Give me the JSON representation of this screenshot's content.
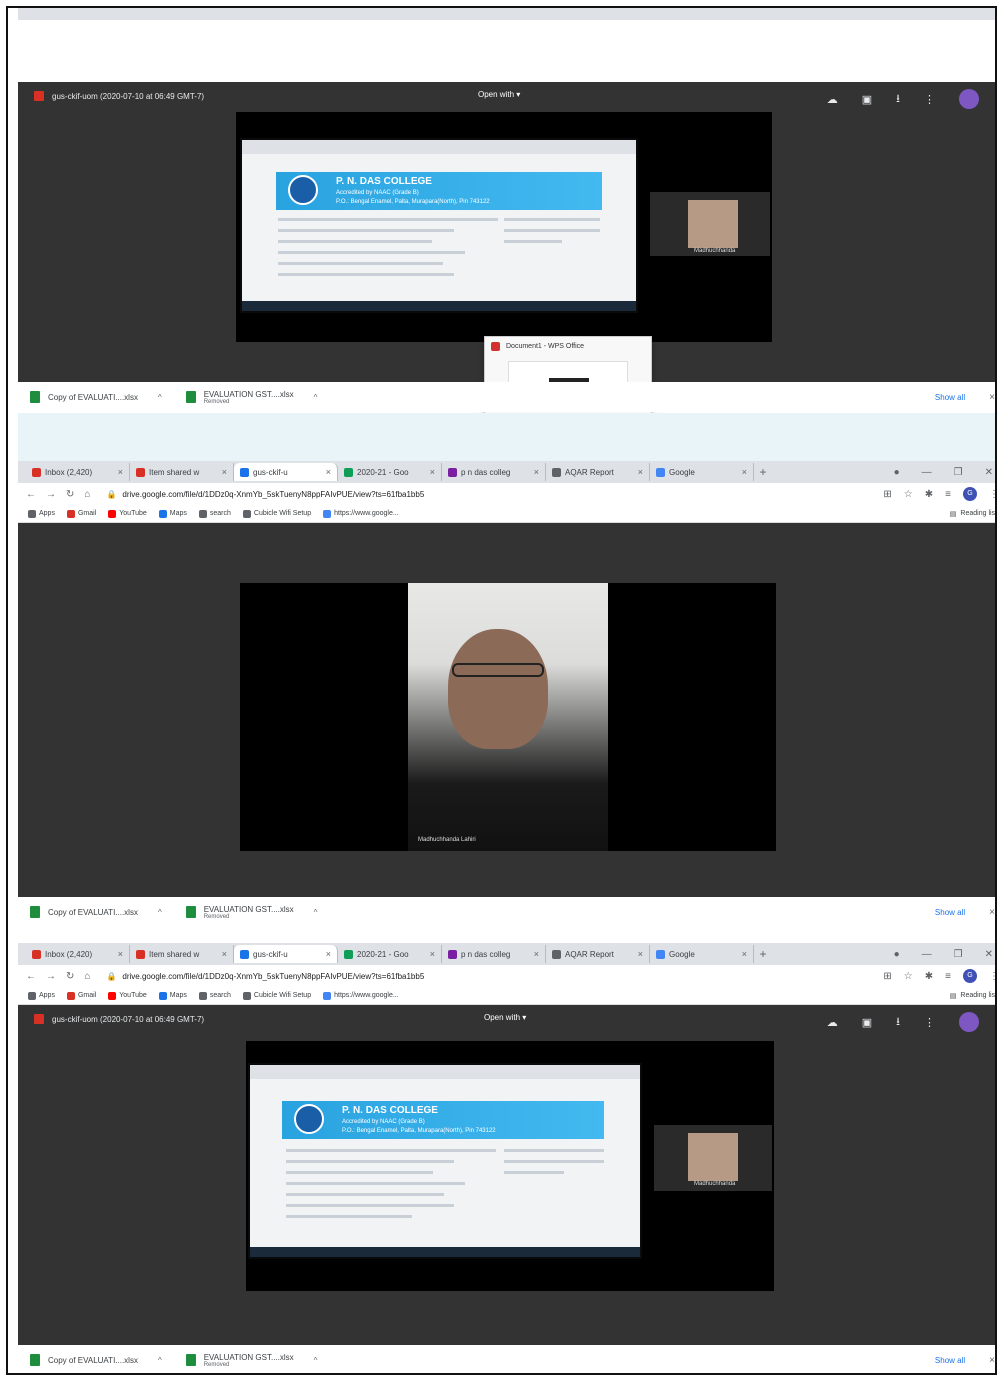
{
  "browser": {
    "tabs": [
      {
        "label": "Inbox (2,420)",
        "color": "#d93025"
      },
      {
        "label": "Item shared w",
        "color": "#d93025"
      },
      {
        "label": "gus-ckif-u",
        "color": "#1a73e8",
        "active": true
      },
      {
        "label": "2020-21 - Goo",
        "color": "#0f9d58"
      },
      {
        "label": "p n das colleg",
        "color": "#7b1fa2"
      },
      {
        "label": "AQAR Report",
        "color": "#5f6368"
      },
      {
        "label": "Google",
        "color": "#4285f4"
      }
    ],
    "new_tab": "+",
    "url": "drive.google.com/file/d/1DDz0q-XnmYb_5skTuenyN8ppFAIvPUE/view?ts=61fba1bb5",
    "bookmarks": [
      {
        "label": "Apps",
        "color": "#5f6368"
      },
      {
        "label": "Gmail",
        "color": "#d93025"
      },
      {
        "label": "YouTube",
        "color": "#ff0000"
      },
      {
        "label": "Maps",
        "color": "#1a73e8"
      },
      {
        "label": "search",
        "color": "#5f6368"
      },
      {
        "label": "Cubicle Wifi Setup",
        "color": "#5f6368"
      },
      {
        "label": "https://www.google...",
        "color": "#4285f4"
      }
    ],
    "reading_list": "Reading list",
    "profile_initial": "G"
  },
  "viewer": {
    "file_title": "gus-ckif-uom (2020-07-10 at 06:49 GMT-7)",
    "open_with": "Open with ▾",
    "screenshare": {
      "college_name": "P. N. DAS COLLEGE",
      "college_sub1": "Accredited by NAAC (Grade B)",
      "college_sub2": "P.O.: Bengal Enamel, Palta, Murapara(North), Pin 743122"
    },
    "participant_small": "Madhuchhanda",
    "participant_name": "Madhuchhanda Lahiri"
  },
  "wps_popup": {
    "title": "Document1 - WPS Office"
  },
  "downloads": {
    "items": [
      {
        "name": "Copy of EVALUATI....xlsx",
        "sub": ""
      },
      {
        "name": "EVALUATION GST....xlsx",
        "sub": "Removed"
      }
    ],
    "show_all": "Show all",
    "close": "×"
  }
}
